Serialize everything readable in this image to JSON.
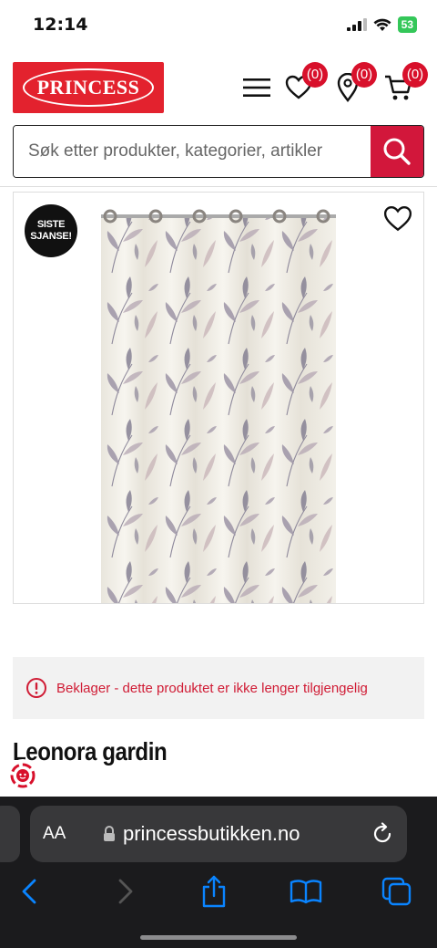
{
  "status_bar": {
    "time": "12:14",
    "battery": "53"
  },
  "header": {
    "logo_text": "PRINCESS",
    "wishlist_count": "(0)",
    "stores_count": "(0)",
    "cart_count": "(0)",
    "icons": [
      "menu-icon",
      "heart-icon",
      "location-icon",
      "cart-icon"
    ]
  },
  "search": {
    "placeholder": "Søk etter produkter, kategorier, artikler"
  },
  "product": {
    "badge_line1": "SISTE",
    "badge_line2": "SJANSE!",
    "title": "Leonora gardin",
    "alert": "Beklager - dette produktet er ikke lenger tilgjengelig"
  },
  "browser": {
    "aa_label": "AA",
    "url": "princessbutikken.no"
  },
  "colors": {
    "brand_red": "#e3222e",
    "search_button": "#d2173b",
    "alert_text": "#d01c35",
    "safari_bg": "#1b1b1d",
    "safari_blue": "#0a84ff"
  }
}
